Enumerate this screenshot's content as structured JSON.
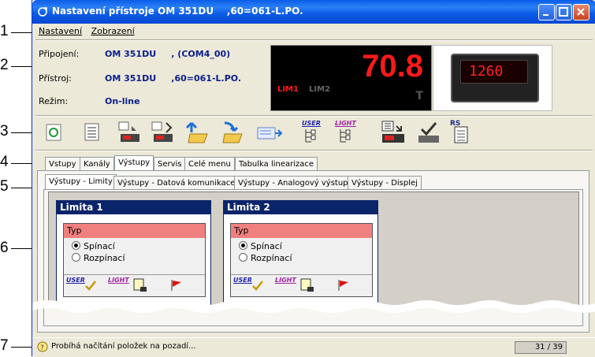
{
  "window": {
    "title": "Nastavení přístroje OM 351DU    ,60=061-L.PO."
  },
  "callouts": [
    "1",
    "2",
    "3",
    "4",
    "5",
    "6",
    "7"
  ],
  "menu": [
    "Nastavení",
    "Zobrazení"
  ],
  "info": {
    "labels": [
      "Připojení:",
      "Přístroj:",
      "Režim:"
    ],
    "values": [
      "OM 351DU     , (COM4_00)",
      "OM 351DU     ,60=061-L.PO.",
      "On-line"
    ]
  },
  "display": {
    "value": "70.8",
    "lim1": "LIM1",
    "lim2": "LIM2",
    "unit": "T",
    "color": "#ff1a1a"
  },
  "device": {
    "readout": "1260"
  },
  "toolbar": {
    "icons": [
      "refresh-icon",
      "list-icon",
      "upload-device-icon",
      "download-device-icon",
      "open-folder-icon",
      "save-folder-icon",
      "export-icon",
      "user-menu-icon",
      "light-menu-icon",
      "device-memory-icon",
      "device-check-icon",
      "rs-document-icon"
    ],
    "user_label": "USER",
    "light_label": "LIGHT",
    "rs_label": "RS"
  },
  "tabs": [
    "Vstupy",
    "Kanály",
    "Výstupy",
    "Servis",
    "Celé menu",
    "Tabulka linearizace"
  ],
  "subtabs": [
    "Výstupy - Limity",
    "Výstupy - Datová komunikace",
    "Výstupy - Analogový výstup",
    "Výstupy - Displej"
  ],
  "limits": [
    {
      "title": "Limita 1",
      "type_label": "Typ",
      "options": [
        "Spínací",
        "Rozpínací"
      ],
      "user": "USER",
      "light": "LIGHT"
    },
    {
      "title": "Limita 2",
      "type_label": "Typ",
      "options": [
        "Spínací",
        "Rozpínací"
      ],
      "user": "USER",
      "light": "LIGHT"
    }
  ],
  "status": {
    "text": "Probíhá načítání položek na pozadí...",
    "count": "31 / 39"
  }
}
